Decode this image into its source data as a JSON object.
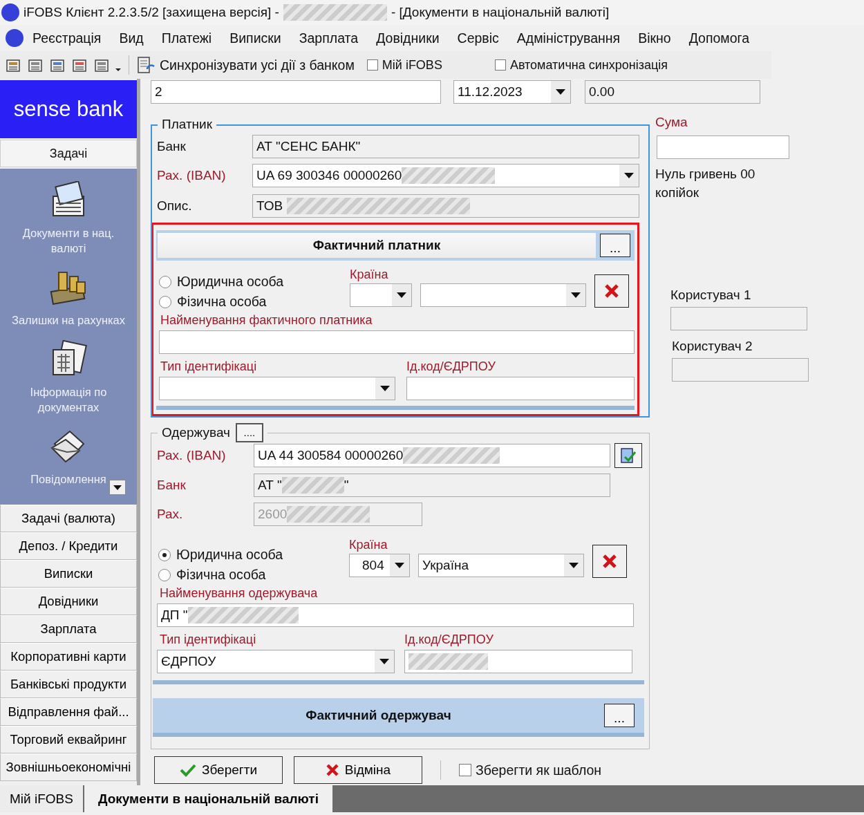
{
  "title_bar": {
    "app_title": "iFOBS Клієнт 2.2.3.5/2 [захищена версія] -",
    "redacted": true,
    "document_title": "- [Документи в національній валюті]"
  },
  "menu": [
    "Реєстрація",
    "Вид",
    "Платежі",
    "Виписки",
    "Зарплата",
    "Довідники",
    "Сервіс",
    "Адміністрування",
    "Вікно",
    "Допомога"
  ],
  "toolbar": {
    "sync_label": "Синхронізувати усі дії з банком",
    "checkboxes": [
      {
        "label": "Мій iFOBS",
        "checked": false
      },
      {
        "label": "Автоматична синхронізація",
        "checked": false
      }
    ]
  },
  "sidebar": {
    "logo": "sense bank",
    "header": "Задачі",
    "tasks": [
      {
        "label": "Документи в нац. валюті",
        "kind": "documents"
      },
      {
        "label": "Залишки на рахунках",
        "kind": "coins"
      },
      {
        "label": "Інформація по документах",
        "kind": "info"
      },
      {
        "label": "Повідомлення",
        "kind": "messages"
      }
    ],
    "sections": [
      "Задачі (валюта)",
      "Депоз. / Кредити",
      "Виписки",
      "Довідники",
      "Зарплата",
      "Корпоративні карти",
      "Банківські продукти",
      "Відправлення фай...",
      "Торговий еквайринг",
      "Зовнішньоекономічні"
    ]
  },
  "document": {
    "number": "2",
    "date": "11.12.2023",
    "amount": "0.00"
  },
  "payer": {
    "legend": "Платник",
    "bank_label": "Банк",
    "bank": "АТ \"СЕНС БАНК\"",
    "iban_label": "Рах. (IBAN)",
    "iban": "UA 69 300346 00000260",
    "iban_redacted": true,
    "description_label": "Опис.",
    "description": "ТОВ",
    "description_redacted": true
  },
  "actual_payer": {
    "highlighted": true,
    "title": "Фактичний платник",
    "more": "...",
    "entity_types": [
      {
        "label": "Юридична особа",
        "selected": false
      },
      {
        "label": "Фізична особа",
        "selected": false
      }
    ],
    "country_label": "Країна",
    "name_label": "Найменування фактичного платника",
    "id_type_label": "Тип ідентифікаці",
    "id_code_label": "Ід.код/ЄДРПОУ"
  },
  "sum": {
    "label": "Сума",
    "words": "Нуль гривень 00 копійок"
  },
  "users": [
    {
      "label": "Користувач 1"
    },
    {
      "label": "Користувач 2"
    }
  ],
  "recipient": {
    "legend": "Одержувач",
    "more": "....",
    "iban_label": "Рах. (IBAN)",
    "iban": "UA 44 300584 00000260",
    "iban_redacted": true,
    "bank_label": "Банк",
    "bank": "АТ \"",
    "bank_redacted": true,
    "bank_suffix": "\"",
    "account_label": "Рах.",
    "account": "2600",
    "account_redacted": true,
    "entity_types": [
      {
        "label": "Юридична особа",
        "selected": true
      },
      {
        "label": "Фізична особа",
        "selected": false
      }
    ],
    "country_label": "Країна",
    "country_code": "804",
    "country_name": "Україна",
    "name_label": "Найменування одержувача",
    "name": "ДП \"",
    "name_redacted": true,
    "id_type_label": "Тип ідентифікаці",
    "id_type": "ЄДРПОУ",
    "id_code_label": "Ід.код/ЄДРПОУ",
    "id_code_redacted": true
  },
  "actual_recipient": {
    "title": "Фактичний одержувач",
    "more": "..."
  },
  "actions": [
    {
      "label": "Зберегти",
      "kind": "save"
    },
    {
      "label": "Відміна",
      "kind": "cancel"
    }
  ],
  "save_template": {
    "label": "Зберегти як шаблон",
    "checked": false
  },
  "bottom_tabs": [
    {
      "label": "Мій iFOBS",
      "selected": false
    },
    {
      "label": "Документи в національній валюті",
      "selected": true
    }
  ]
}
